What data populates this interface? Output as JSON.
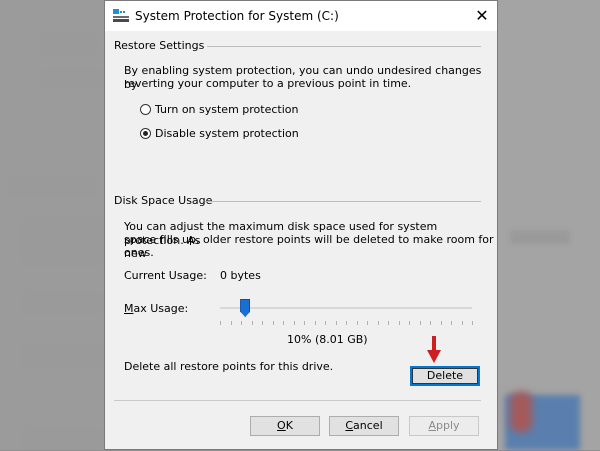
{
  "dialog": {
    "title": "System Protection for System (C:)",
    "close_glyph": "✕"
  },
  "restore_settings": {
    "heading": "Restore Settings",
    "description_line1": "By enabling system protection, you can undo undesired changes by",
    "description_line2": "reverting your computer to a previous point in time.",
    "options": [
      {
        "label": "Turn on system protection",
        "checked": false
      },
      {
        "label": "Disable system protection",
        "checked": true
      }
    ]
  },
  "disk_space": {
    "heading": "Disk Space Usage",
    "description_line1": "You can adjust the maximum disk space used for system protection. As",
    "description_line2": "space fills up, older restore points will be deleted to make room for new",
    "description_line3": "ones.",
    "current_usage_label": "Current Usage:",
    "current_usage_value": "0 bytes",
    "max_usage_label_prefix": "M",
    "max_usage_label_rest": "ax Usage:",
    "max_usage_fraction": 0.1,
    "max_usage_value": "10% (8.01 GB)",
    "delete_text": "Delete all restore points for this drive.",
    "delete_button": "Delete"
  },
  "footer": {
    "ok_prefix": "O",
    "ok_rest": "K",
    "cancel_prefix": "C",
    "cancel_rest": "ancel",
    "apply_prefix": "A",
    "apply_rest": "pply"
  },
  "colors": {
    "accent": "#0078d7",
    "slider_thumb": "#1a6fd2",
    "arrow": "#cc1f1f"
  }
}
